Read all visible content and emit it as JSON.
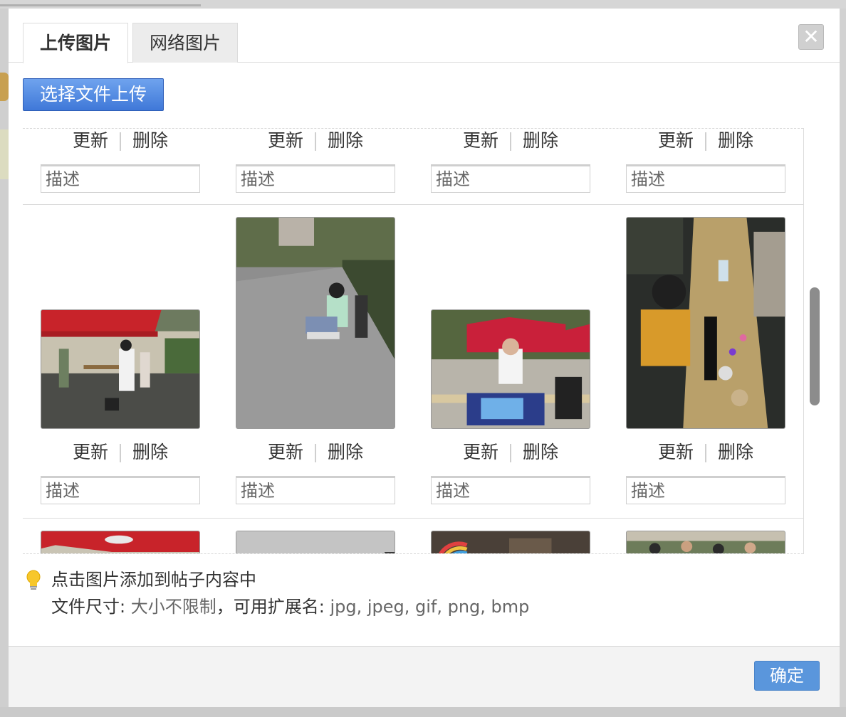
{
  "dialog": {
    "tabs": [
      {
        "label": "上传图片",
        "active": true
      },
      {
        "label": "网络图片",
        "active": false
      }
    ],
    "close_glyph": "✕",
    "upload_button": "选择文件上传",
    "row_actions": {
      "update": "更新",
      "delete": "删除"
    },
    "description_placeholder": "描述",
    "hint_line1": "点击图片添加到帖子内容中",
    "hint_line2_label": "文件尺寸: ",
    "hint_line2_size": "大小不限制",
    "hint_line2_ext_label": "，可用扩展名: ",
    "hint_line2_ext": "jpg, jpeg, gif, png, bmp",
    "ok_button": "确定"
  },
  "icons": {
    "close": "close-icon",
    "hint": "lightbulb-icon"
  },
  "colors": {
    "accent": "#5a96dc",
    "upload_button": "#4a83df"
  }
}
